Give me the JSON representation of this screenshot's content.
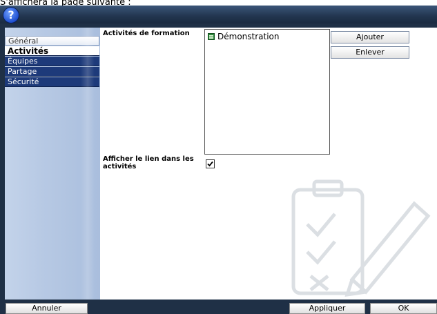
{
  "caption": "S'affichera la page suivante :",
  "titlebar": {
    "help_icon": "?"
  },
  "sidebar": {
    "items": [
      {
        "label": "Général"
      },
      {
        "label": "Activités"
      },
      {
        "label": "Équipes"
      },
      {
        "label": "Partage"
      },
      {
        "label": "Sécurité"
      }
    ]
  },
  "main": {
    "activities_label": "Activités de formation",
    "list_items": [
      "Démonstration"
    ],
    "add_button": "Ajouter",
    "remove_button": "Enlever",
    "show_link_label": "Afficher le lien dans les activités",
    "show_link_checked": true
  },
  "footer": {
    "cancel": "Annuler",
    "apply": "Appliquer",
    "ok": "OK"
  },
  "colors": {
    "titlebar": "#22354f",
    "sidebar_tab": "#1d3a7a",
    "sidebar_bg": "#b7c9e4"
  }
}
